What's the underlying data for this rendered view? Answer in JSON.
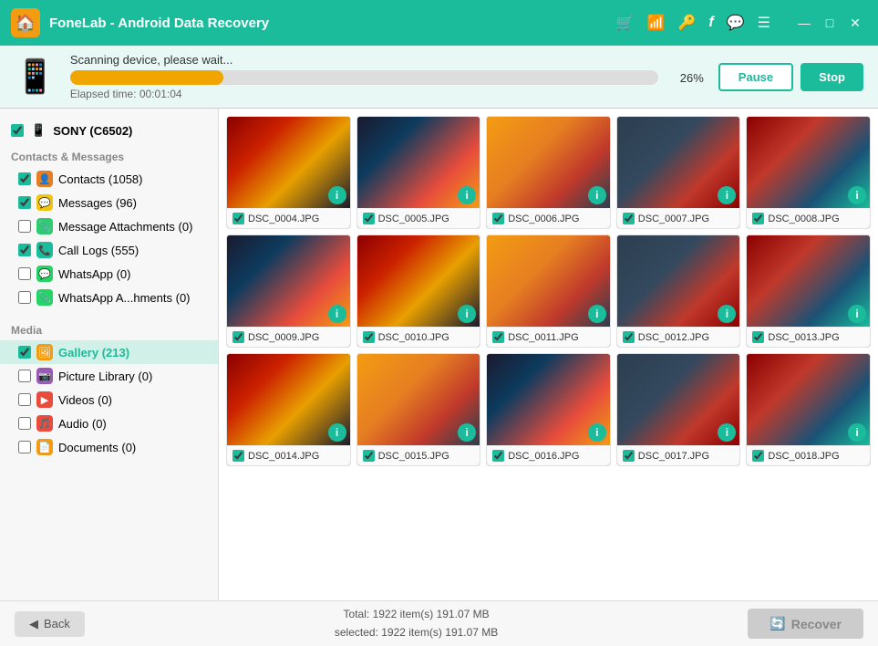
{
  "app": {
    "title": "FoneLab - Android Data Recovery",
    "logo_char": "🏠"
  },
  "titlebar": {
    "icons": [
      "🛒",
      "📶",
      "🔑",
      "f",
      "💬",
      "☰"
    ],
    "win_min": "—",
    "win_max": "□",
    "win_close": "✕"
  },
  "scan": {
    "status": "Scanning device, please wait...",
    "progress_pct": 26,
    "progress_label": "26%",
    "elapsed_label": "Elapsed time: 00:01:04",
    "pause_label": "Pause",
    "stop_label": "Stop"
  },
  "sidebar": {
    "device_label": "SONY (C6502)",
    "sections": [
      {
        "name": "Contacts & Messages",
        "items": [
          {
            "id": "contacts",
            "label": "Contacts (1058)",
            "icon_class": "icon-contacts",
            "icon_char": "👤",
            "checked": true
          },
          {
            "id": "messages",
            "label": "Messages (96)",
            "icon_class": "icon-messages",
            "icon_char": "💬",
            "checked": true
          },
          {
            "id": "msgattach",
            "label": "Message Attachments (0)",
            "icon_class": "icon-msgattach",
            "icon_char": "📎",
            "checked": false
          },
          {
            "id": "calllogs",
            "label": "Call Logs (555)",
            "icon_class": "icon-calllogs",
            "icon_char": "📞",
            "checked": true
          },
          {
            "id": "whatsapp",
            "label": "WhatsApp (0)",
            "icon_class": "icon-whatsapp",
            "icon_char": "💬",
            "checked": false
          },
          {
            "id": "whatsappattach",
            "label": "WhatsApp A...hments (0)",
            "icon_class": "icon-whatsapp",
            "icon_char": "📎",
            "checked": false
          }
        ]
      },
      {
        "name": "Media",
        "items": [
          {
            "id": "gallery",
            "label": "Gallery (213)",
            "icon_class": "icon-gallery",
            "icon_char": "🖼",
            "checked": true,
            "active": true
          },
          {
            "id": "pictlib",
            "label": "Picture Library (0)",
            "icon_class": "icon-pictlib",
            "icon_char": "📷",
            "checked": false
          },
          {
            "id": "videos",
            "label": "Videos (0)",
            "icon_class": "icon-videos",
            "icon_char": "▶",
            "checked": false
          },
          {
            "id": "audio",
            "label": "Audio (0)",
            "icon_class": "icon-audio",
            "icon_char": "🎵",
            "checked": false
          },
          {
            "id": "documents",
            "label": "Documents (0)",
            "icon_class": "icon-docs",
            "icon_char": "📄",
            "checked": false
          }
        ]
      }
    ]
  },
  "photos": [
    {
      "name": "DSC_0004.JPG",
      "color": "img-t1"
    },
    {
      "name": "DSC_0005.JPG",
      "color": "img-t2"
    },
    {
      "name": "DSC_0006.JPG",
      "color": "img-t3"
    },
    {
      "name": "DSC_0007.JPG",
      "color": "img-t4"
    },
    {
      "name": "DSC_0008.JPG",
      "color": "img-t5"
    },
    {
      "name": "DSC_0009.JPG",
      "color": "img-t2"
    },
    {
      "name": "DSC_0010.JPG",
      "color": "img-t1"
    },
    {
      "name": "DSC_0011.JPG",
      "color": "img-t3"
    },
    {
      "name": "DSC_0012.JPG",
      "color": "img-t4"
    },
    {
      "name": "DSC_0013.JPG",
      "color": "img-t5"
    },
    {
      "name": "DSC_0014.JPG",
      "color": "img-t1"
    },
    {
      "name": "DSC_0015.JPG",
      "color": "img-t3"
    },
    {
      "name": "DSC_0016.JPG",
      "color": "img-t2"
    },
    {
      "name": "DSC_0017.JPG",
      "color": "img-t4"
    },
    {
      "name": "DSC_0018.JPG",
      "color": "img-t5"
    }
  ],
  "bottom": {
    "back_label": "Back",
    "total_line1": "Total: 1922 item(s)  191.07 MB",
    "total_line2": "selected: 1922 item(s)  191.07 MB",
    "recover_label": "Recover"
  }
}
